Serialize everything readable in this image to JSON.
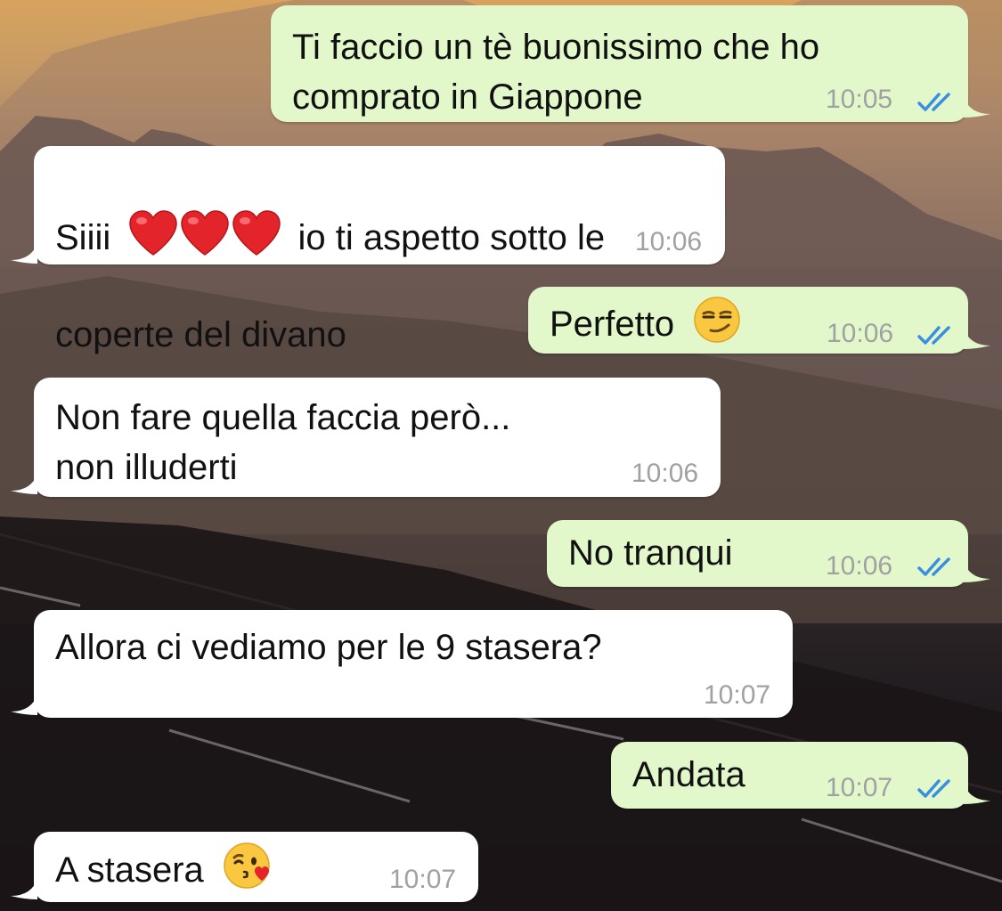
{
  "chat": {
    "messages": [
      {
        "direction": "outgoing",
        "text": "Ti faccio un tè buonissimo che ho\ncomprato in Giappone",
        "time": "10:05",
        "status": "read"
      },
      {
        "direction": "incoming",
        "text_before": "Siiii",
        "emoji": [
          "red-heart",
          "red-heart",
          "red-heart"
        ],
        "text_after": "io ti aspetto sotto le",
        "text_line2": "coperte del divano",
        "time": "10:06"
      },
      {
        "direction": "outgoing",
        "text": "Perfetto",
        "emoji": [
          "smirking-face"
        ],
        "time": "10:06",
        "status": "read"
      },
      {
        "direction": "incoming",
        "text": "Non fare quella faccia però...\nnon illuderti",
        "time": "10:06"
      },
      {
        "direction": "outgoing",
        "text": "No tranqui",
        "time": "10:06",
        "status": "read"
      },
      {
        "direction": "incoming",
        "text": "Allora ci vediamo per le 9 stasera?",
        "time": "10:07"
      },
      {
        "direction": "outgoing",
        "text": "Andata",
        "time": "10:07",
        "status": "read"
      },
      {
        "direction": "incoming",
        "text": "A stasera",
        "emoji": [
          "face-blowing-a-kiss"
        ],
        "time": "10:07"
      }
    ]
  },
  "colors": {
    "outgoing_bubble": "#e2f8cb",
    "incoming_bubble": "#ffffff",
    "read_ticks": "#3a8fe0",
    "timestamp": "#a1a1a1"
  }
}
